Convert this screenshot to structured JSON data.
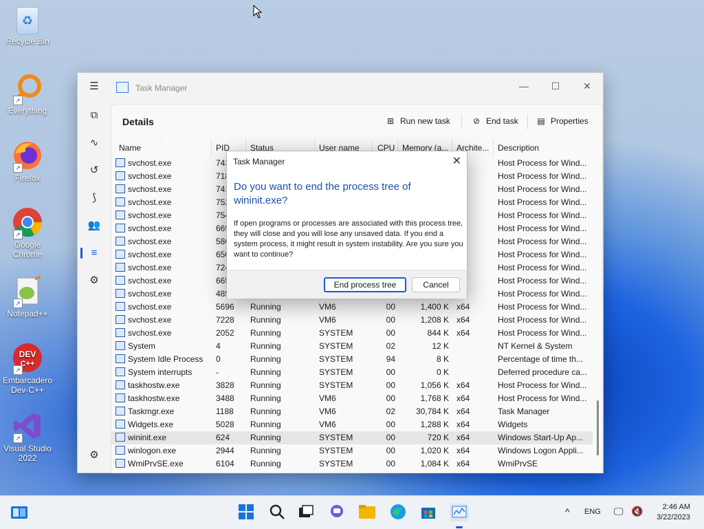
{
  "desktop": {
    "icons": [
      {
        "label": "Recycle Bin",
        "icon": "recycle-bin-icon",
        "color": "#cfe3f5"
      },
      {
        "label": "Everything",
        "icon": "magnifier-icon",
        "color": "#f08a1c"
      },
      {
        "label": "Firefox",
        "icon": "firefox-icon",
        "color": "#e8511c"
      },
      {
        "label": "Google Chrome",
        "icon": "chrome-icon",
        "color": "#34a853"
      },
      {
        "label": "Notepad++",
        "icon": "notepad-plus-plus-icon",
        "color": "#8bc34a"
      },
      {
        "label": "Embarcadero Dev-C++",
        "icon": "devcpp-icon",
        "color": "#d82a2a"
      },
      {
        "label": "Visual Studio 2022",
        "icon": "visual-studio-icon",
        "color": "#7c4dce"
      }
    ]
  },
  "window": {
    "title": "Task Manager",
    "page_title": "Details",
    "toolbar": {
      "run_new_task": "Run new task",
      "end_task": "End task",
      "properties": "Properties"
    },
    "columns": [
      "Name",
      "PID",
      "Status",
      "User name",
      "CPU",
      "Memory (a...",
      "Archite...",
      "Description"
    ],
    "rows": [
      {
        "name": "svchost.exe",
        "pid": "743",
        "status": "",
        "user": "",
        "cpu": "",
        "mem": "",
        "arch": "",
        "desc": "Host Process for Wind..."
      },
      {
        "name": "svchost.exe",
        "pid": "718",
        "status": "",
        "user": "",
        "cpu": "",
        "mem": "",
        "arch": "",
        "desc": "Host Process for Wind..."
      },
      {
        "name": "svchost.exe",
        "pid": "741",
        "status": "",
        "user": "",
        "cpu": "",
        "mem": "",
        "arch": "",
        "desc": "Host Process for Wind..."
      },
      {
        "name": "svchost.exe",
        "pid": "752",
        "status": "",
        "user": "",
        "cpu": "",
        "mem": "",
        "arch": "",
        "desc": "Host Process for Wind..."
      },
      {
        "name": "svchost.exe",
        "pid": "754",
        "status": "",
        "user": "",
        "cpu": "",
        "mem": "",
        "arch": "",
        "desc": "Host Process for Wind..."
      },
      {
        "name": "svchost.exe",
        "pid": "669",
        "status": "",
        "user": "",
        "cpu": "",
        "mem": "",
        "arch": "",
        "desc": "Host Process for Wind..."
      },
      {
        "name": "svchost.exe",
        "pid": "586",
        "status": "",
        "user": "",
        "cpu": "",
        "mem": "",
        "arch": "",
        "desc": "Host Process for Wind..."
      },
      {
        "name": "svchost.exe",
        "pid": "650",
        "status": "",
        "user": "",
        "cpu": "",
        "mem": "",
        "arch": "",
        "desc": "Host Process for Wind..."
      },
      {
        "name": "svchost.exe",
        "pid": "724",
        "status": "",
        "user": "",
        "cpu": "",
        "mem": "",
        "arch": "",
        "desc": "Host Process for Wind..."
      },
      {
        "name": "svchost.exe",
        "pid": "665",
        "status": "",
        "user": "",
        "cpu": "",
        "mem": "",
        "arch": "",
        "desc": "Host Process for Wind..."
      },
      {
        "name": "svchost.exe",
        "pid": "485",
        "status": "",
        "user": "",
        "cpu": "",
        "mem": "",
        "arch": "",
        "desc": "Host Process for Wind..."
      },
      {
        "name": "svchost.exe",
        "pid": "5696",
        "status": "Running",
        "user": "VM6",
        "cpu": "00",
        "mem": "1,400 K",
        "arch": "x64",
        "desc": "Host Process for Wind..."
      },
      {
        "name": "svchost.exe",
        "pid": "7228",
        "status": "Running",
        "user": "VM6",
        "cpu": "00",
        "mem": "1,208 K",
        "arch": "x64",
        "desc": "Host Process for Wind..."
      },
      {
        "name": "svchost.exe",
        "pid": "2052",
        "status": "Running",
        "user": "SYSTEM",
        "cpu": "00",
        "mem": "844 K",
        "arch": "x64",
        "desc": "Host Process for Wind..."
      },
      {
        "name": "System",
        "pid": "4",
        "status": "Running",
        "user": "SYSTEM",
        "cpu": "02",
        "mem": "12 K",
        "arch": "",
        "desc": "NT Kernel & System"
      },
      {
        "name": "System Idle Process",
        "pid": "0",
        "status": "Running",
        "user": "SYSTEM",
        "cpu": "94",
        "mem": "8 K",
        "arch": "",
        "desc": "Percentage of time th..."
      },
      {
        "name": "System interrupts",
        "pid": "-",
        "status": "Running",
        "user": "SYSTEM",
        "cpu": "00",
        "mem": "0 K",
        "arch": "",
        "desc": "Deferred procedure ca..."
      },
      {
        "name": "taskhostw.exe",
        "pid": "3828",
        "status": "Running",
        "user": "SYSTEM",
        "cpu": "00",
        "mem": "1,056 K",
        "arch": "x64",
        "desc": "Host Process for Wind..."
      },
      {
        "name": "taskhostw.exe",
        "pid": "3488",
        "status": "Running",
        "user": "VM6",
        "cpu": "00",
        "mem": "1,768 K",
        "arch": "x64",
        "desc": "Host Process for Wind..."
      },
      {
        "name": "Taskmgr.exe",
        "pid": "1188",
        "status": "Running",
        "user": "VM6",
        "cpu": "02",
        "mem": "30,784 K",
        "arch": "x64",
        "desc": "Task Manager"
      },
      {
        "name": "Widgets.exe",
        "pid": "5028",
        "status": "Running",
        "user": "VM6",
        "cpu": "00",
        "mem": "1,288 K",
        "arch": "x64",
        "desc": "Widgets"
      },
      {
        "name": "wininit.exe",
        "pid": "624",
        "status": "Running",
        "user": "SYSTEM",
        "cpu": "00",
        "mem": "720 K",
        "arch": "x64",
        "desc": "Windows Start-Up Ap..."
      },
      {
        "name": "winlogon.exe",
        "pid": "2944",
        "status": "Running",
        "user": "SYSTEM",
        "cpu": "00",
        "mem": "1,020 K",
        "arch": "x64",
        "desc": "Windows Logon Appli..."
      },
      {
        "name": "WmiPrvSE.exe",
        "pid": "6104",
        "status": "Running",
        "user": "SYSTEM",
        "cpu": "00",
        "mem": "1,084 K",
        "arch": "x64",
        "desc": "WmiPrvSE"
      }
    ],
    "selected_row": 21
  },
  "dialog": {
    "title": "Task Manager",
    "heading": "Do you want to end the process tree of wininit.exe?",
    "body": "If open programs or processes are associated with this process tree, they will close and you will lose any unsaved data. If you end a system process, it might result in system instability. Are you sure you want to continue?",
    "primary_button": "End process tree",
    "cancel_button": "Cancel"
  },
  "taskbar": {
    "language": "ENG",
    "time": "2:46 AM",
    "date": "3/22/2023"
  },
  "colors": {
    "accent": "#1a5ad6",
    "dialog_heading": "#1c4fa8"
  }
}
